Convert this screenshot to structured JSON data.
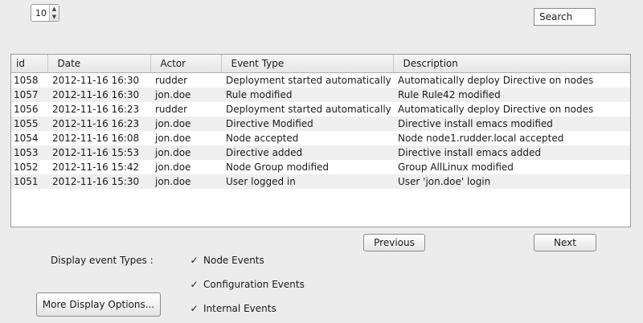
{
  "page_size": {
    "value": "10"
  },
  "search": {
    "label": "Search"
  },
  "table": {
    "columns": [
      "id",
      "Date",
      "Actor",
      "Event Type",
      "Description"
    ],
    "rows": [
      [
        "1058",
        "2012-11-16 16:30",
        "rudder",
        "Deployment started automatically",
        "Automatically deploy Directive on nodes"
      ],
      [
        "1057",
        "2012-11-16 16:30",
        "jon.doe",
        "Rule modified",
        "Rule Rule42 modified"
      ],
      [
        "1056",
        "2012-11-16 16:23",
        "rudder",
        "Deployment started automatically",
        "Automatically deploy Directive on nodes"
      ],
      [
        "1055",
        "2012-11-16 16:23",
        "jon.doe",
        "Directive Modified",
        "Directive install emacs modified"
      ],
      [
        "1054",
        "2012-11-16 16:08",
        "jon.doe",
        "Node accepted",
        "Node node1.rudder.local accepted"
      ],
      [
        "1053",
        "2012-11-16 15:53",
        "jon.doe",
        "Directive added",
        "Directive install emacs added"
      ],
      [
        "1052",
        "2012-11-16 15:42",
        "jon.doe",
        "Node Group modified",
        "Group AllLinux modified"
      ],
      [
        "1051",
        "2012-11-16 15:30",
        "jon.doe",
        "User logged in",
        "User 'jon.doe' login"
      ]
    ]
  },
  "pagination": {
    "previous": "Previous",
    "next": "Next"
  },
  "filters": {
    "label": "Display event Types :",
    "options": [
      {
        "label": "Node Events",
        "checked": true
      },
      {
        "label": "Configuration Events",
        "checked": true
      },
      {
        "label": "Internal Events",
        "checked": true
      }
    ]
  },
  "more_options": {
    "label": "More Display Options..."
  }
}
